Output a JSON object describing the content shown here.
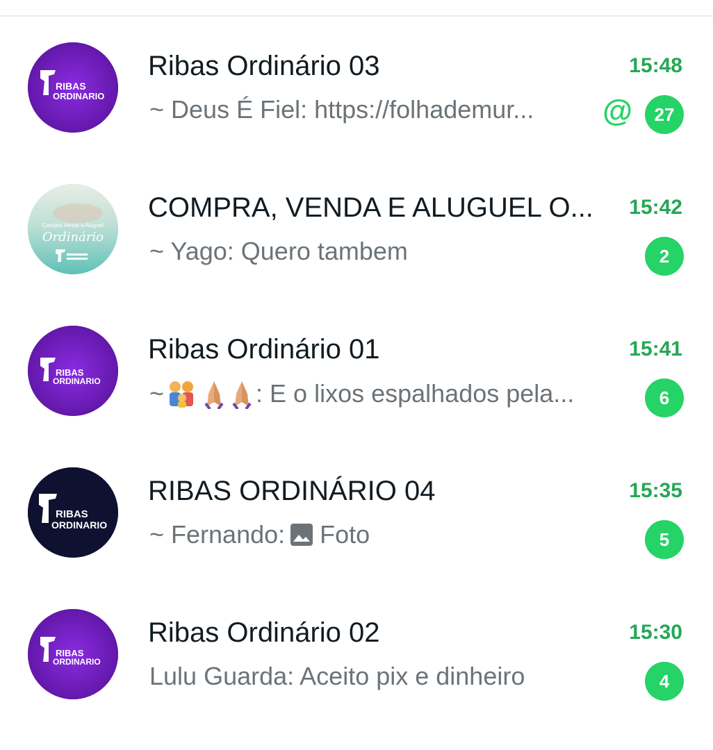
{
  "chats": [
    {
      "title": "Ribas Ordinário 03",
      "time": "15:48",
      "preview": "~ Deus É Fiel: https://folhademur...",
      "mention": "@",
      "unread": "27",
      "avatar_text_1": "RIBAS",
      "avatar_text_2": "ORDINARIO",
      "avatar_bg": "#6a1bb5"
    },
    {
      "title": "COMPRA, VENDA E ALUGUEL O...",
      "time": "15:42",
      "preview": "~ Yago: Quero tambem",
      "unread": "2",
      "avatar_text_1": "Compra Venda e Aluguel",
      "avatar_text_2": "Ordinário",
      "avatar_bg": "#7cc9c3"
    },
    {
      "title": "Ribas Ordinário 01",
      "time": "15:41",
      "preview_prefix": "~",
      "preview": ": E o lixos espalhados pela...",
      "unread": "6",
      "avatar_text_1": "RIBAS",
      "avatar_text_2": "ORDINARIO",
      "avatar_bg": "#6a1bb5"
    },
    {
      "title": "RIBAS ORDINÁRIO 04",
      "time": "15:35",
      "preview_sender": "~ Fernando:",
      "preview": "Foto",
      "preview_icon": "photo-icon",
      "unread": "5",
      "avatar_text_1": "RIBAS",
      "avatar_text_2": "ORDINARIO",
      "avatar_bg": "#0e1130"
    },
    {
      "title": "Ribas Ordinário 02",
      "time": "15:30",
      "preview": "Lulu Guarda: Aceito pix e dinheiro",
      "unread": "4",
      "avatar_text_1": "RIBAS",
      "avatar_text_2": "ORDINARIO",
      "avatar_bg": "#6a1bb5"
    }
  ],
  "colors": {
    "accent": "#25d366",
    "time": "#25a756",
    "title": "#111b21",
    "preview": "#6b7378"
  }
}
